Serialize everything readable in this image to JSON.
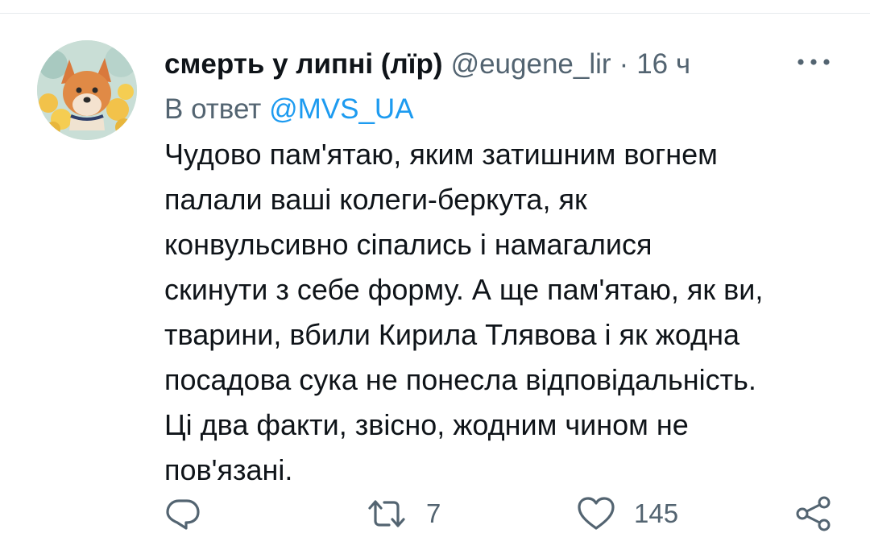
{
  "tweet": {
    "author": {
      "display_name": "смерть у липні (лїр)",
      "handle": "@eugene_lir"
    },
    "separator": "·",
    "time": "16 ч",
    "reply_to": {
      "prefix": "В ответ",
      "mention": "@MVS_UA"
    },
    "text_lines": [
      "Чудово пам'ятаю, яким затишним вогнем",
      "палали ваші колеги-беркута, як",
      "конвульсивно сіпались і намагалися",
      "скинути з себе форму. А ще пам'ятаю, як ви,",
      "тварини, вбили Кирила Тлявова і як жодна",
      "посадова сука не понесла відповідальність.",
      "Ці два факти, звісно, жодним чином не",
      "пов'язані."
    ],
    "actions": {
      "reply_icon": "reply-icon",
      "retweet_icon": "retweet-icon",
      "retweet_count": "7",
      "like_icon": "heart-icon",
      "like_count": "145",
      "share_icon": "share-icon"
    },
    "more_icon": "more-dots-icon"
  },
  "colors": {
    "text_primary": "#0f1419",
    "text_secondary": "#536471",
    "link": "#1d9bf0",
    "divider": "#e7eaed"
  }
}
